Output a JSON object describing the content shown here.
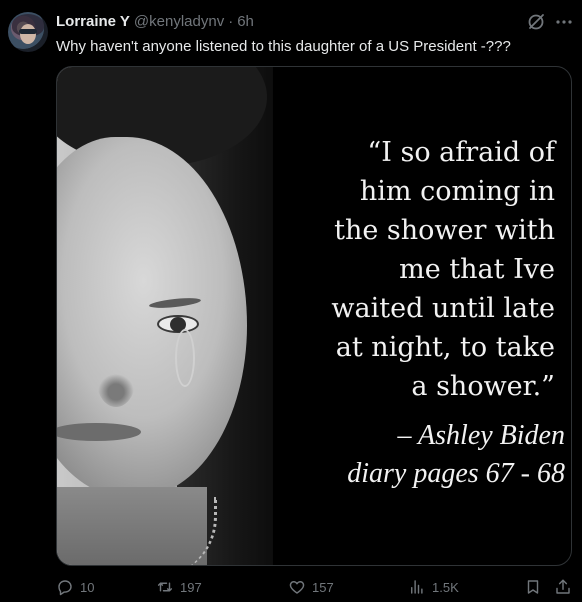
{
  "tweet": {
    "author_name": "Lorraine Y",
    "author_handle": "@kenyladynv",
    "separator": "·",
    "time": "6h",
    "text": "Why haven't anyone listened to this daughter of a US President -???"
  },
  "media": {
    "quote_lines": [
      "“I so afraid of",
      "him coming in",
      "the shower with",
      "me that Ive",
      "waited until late",
      "at night, to take",
      "a shower.”"
    ],
    "attribution_lines": [
      "– Ashley Biden",
      "diary pages 67 - 68"
    ]
  },
  "actions": {
    "reply_count": "10",
    "retweet_count": "197",
    "like_count": "157",
    "views_count": "1.5K"
  },
  "icons": {
    "grok": "grok-icon",
    "more": "more-icon",
    "reply": "reply-icon",
    "retweet": "retweet-icon",
    "like": "heart-icon",
    "views": "views-icon",
    "bookmark": "bookmark-icon",
    "share": "share-icon"
  },
  "colors": {
    "background": "#000000",
    "text_primary": "#e7e9ea",
    "text_secondary": "#71767b",
    "border": "#2f3336"
  }
}
